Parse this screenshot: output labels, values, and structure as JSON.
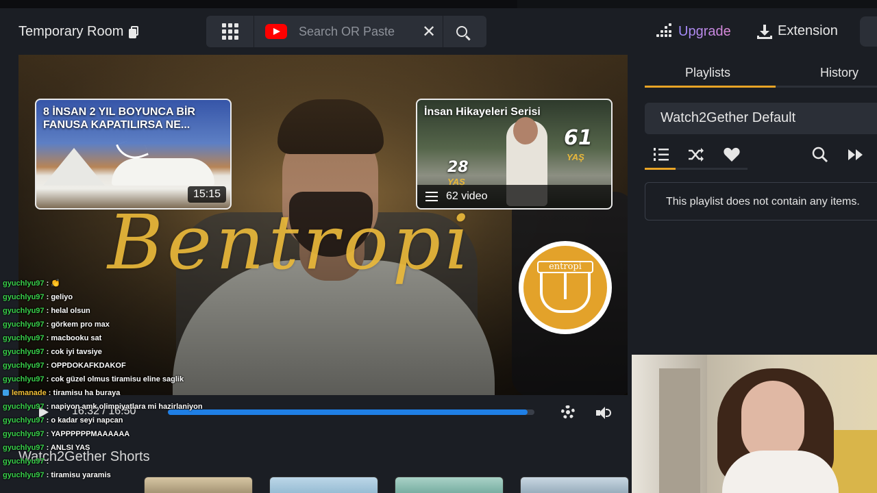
{
  "header": {
    "room_title": "Temporary Room",
    "search_placeholder": "Search OR Paste",
    "upgrade_label": "Upgrade",
    "extension_label": "Extension"
  },
  "video": {
    "watermark": "Bentropi",
    "logo_text": "entropi",
    "card1": {
      "title": "8 İNSAN 2 YIL BOYUNCA BİR FANUSA KAPATILIRSA NE...",
      "duration": "15:15"
    },
    "card2": {
      "title": "İnsan Hikayeleri Serisi",
      "count": "62 video",
      "num_a": "61",
      "num_b": "28",
      "unit": "YAŞ"
    },
    "time": "16:32 / 16:50",
    "progress": 0.982
  },
  "shorts": {
    "title": "Watch2Gether Shorts"
  },
  "chat": [
    {
      "user": "gyuchlyu97",
      "msg": "👏",
      "alt": false
    },
    {
      "user": "gyuchlyu97",
      "msg": "geliyo",
      "alt": false
    },
    {
      "user": "gyuchlyu97",
      "msg": "helal olsun",
      "alt": false
    },
    {
      "user": "gyuchlyu97",
      "msg": "görkem pro max",
      "alt": false
    },
    {
      "user": "gyuchlyu97",
      "msg": "macbooku sat",
      "alt": false
    },
    {
      "user": "gyuchlyu97",
      "msg": "cok iyi tavsiye",
      "alt": false
    },
    {
      "user": "gyuchlyu97",
      "msg": "OPPDOKAFKDAKOF",
      "alt": false
    },
    {
      "user": "gyuchlyu97",
      "msg": "cok güzel olmus tiramisu eline saglik",
      "alt": false
    },
    {
      "user": "lemanade",
      "msg": "tiramisu ha buraya",
      "alt": true
    },
    {
      "user": "gyuchlyu97",
      "msg": "napiyon amk olimpiyatlara mi hazirlaniyon",
      "alt": false
    },
    {
      "user": "gyuchlyu97",
      "msg": "o kadar seyi napcan",
      "alt": false
    },
    {
      "user": "gyuchlyu97",
      "msg": "YAPPPPPPMAAAAAA",
      "alt": false
    },
    {
      "user": "gyuchlyu97",
      "msg": "ANLSI YAS",
      "alt": false
    },
    {
      "user": "gyuchlyu97",
      "msg": "",
      "alt": false
    },
    {
      "user": "gyuchlyu97",
      "msg": "tiramisu yaramis",
      "alt": false
    }
  ],
  "panel": {
    "tabs": [
      "Playlists",
      "History"
    ],
    "playlist_name": "Watch2Gether Default",
    "empty_message": "This playlist does not contain any items."
  },
  "colors": {
    "accent": "#e9a426",
    "progress": "#1f7fe5",
    "chat_user": "#39d14b"
  }
}
